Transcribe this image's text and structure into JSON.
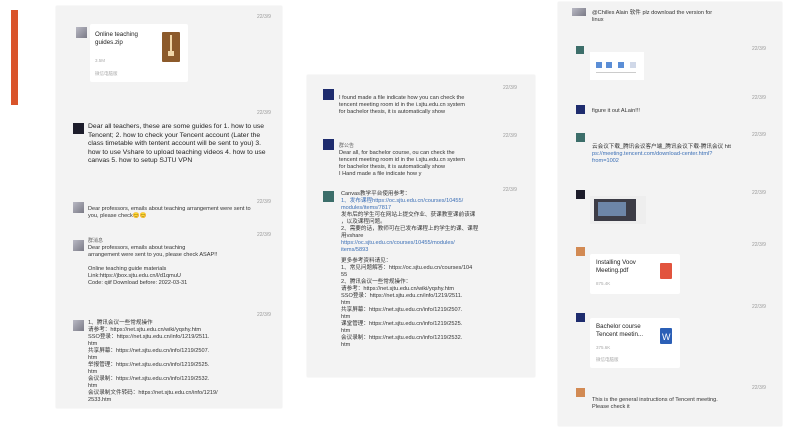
{
  "panel1": {
    "msg1": {
      "time": "22/3/9",
      "file_name": "Online teaching guides.zip",
      "file_size": "3.5M",
      "file_source": "微信电脑版"
    },
    "msg2": {
      "time": "22/3/9",
      "text": "Dear all teachers, these are some guides for 1. how to use Tencent; 2. how to check your Tencent account (Later the class timetable with tentent account will be sent to you) 3. how to use Vshare to upload teaching videos 4. how to use canvas 5. how to setup SJTU VPN"
    },
    "msg3": {
      "time": "22/3/9",
      "text": "Dear professors,  emails about teaching arrangement were sent to you, please check😊😊"
    },
    "msg4": {
      "time": "22/3/9",
      "sender": "群消息",
      "lines": [
        "Dear professors,  emails about teaching",
        "arrangement were sent to you, please check ASAP!!",
        "",
        "Online teaching guide materials",
        "Link:https://jbox.sjtu.edu.cn/l/d1qmuU",
        "Code: qiif  Download before: 2022-03-31"
      ]
    },
    "msg5": {
      "time": "22/3/9",
      "lines": [
        "1、腾讯会议一些常规操作",
        "   请参考：https://net.sjtu.edu.cn/wiki/yqshy.htm",
        "   SSO登录：https://net.sjtu.edu.cn/info/1219/2511.",
        "   htm",
        "   共享屏幕：https://net.sjtu.edu.cn/info/1219/2507.",
        "   htm",
        "   举报管理：https://net.sjtu.edu.cn/info/1219/2525.",
        "   htm",
        "   会议录制：https://net.sjtu.edu.cn/info/1219/2532.",
        "   htm",
        "   会议录制文件转码：https://net.sjtu.edu.cn/info/1219/",
        "   2533.htm"
      ]
    }
  },
  "panel2": {
    "msg1": {
      "time": "22/3/9",
      "lines": [
        "I found made a file indicate how you can check the",
        "tencent meeting room id in the i.sjtu.edu.cn system",
        "for bachelor thesis, it is automatically show"
      ]
    },
    "msg2": {
      "time": "22/3/9",
      "sender": "群公告",
      "lines": [
        "Dear all, for bachelor course, ou can check the",
        "tencent meeting room id in the i.sjtu.edu.cn system",
        "for bachelor thesis, it is automatically show",
        "I Hand made a file indicate how y"
      ]
    },
    "msg3": {
      "time": "22/3/9",
      "lines": [
        "Canvas教学平台使用参考：",
        "1、发布课程https://oc.sjtu.edu.cn/courses/10455/",
        "modules/items/7817",
        "发布后的学生可在网站上提交作业、获课教室课前该课",
        "，以及课程问题。",
        "2、需要的话，教师可在已发布课程上的学生的课、课程",
        "用vshare",
        "https://oc.sjtu.edu.cn/courses/10455/modules/",
        "items/5893",
        "",
        "更多参考资料请见：",
        "1、常见问题解答：https://oc.sjtu.edu.cn/courses/104",
        "55",
        "2、腾讯会议一些常规操作：",
        "请参考：https://net.sjtu.edu.cn/wiki/yqshy.htm",
        "SSO登录：https://net.sjtu.edu.cn/info/1219/2511.",
        "htm",
        "共享屏幕：https://net.sjtu.edu.cn/info/1219/2507.",
        "htm",
        "课堂管理：https://net.sjtu.edu.cn/info/1219/2525.",
        "htm",
        "会议录制：https://net.sjtu.edu.cn/info/1219/2532.",
        "htm"
      ]
    }
  },
  "panel3": {
    "msg0": {
      "lines": [
        "@Chilles Alain 软件 plz download the version for",
        "linux"
      ]
    },
    "msg1": {
      "time": "22/3/9"
    },
    "msg2": {
      "time": "22/3/9",
      "text": "figure it out ALain!!!"
    },
    "msg3": {
      "time": "22/3/9",
      "lines": [
        "云会议下载_腾讯会议客户端_腾讯会议下载-腾讯会议  htt",
        "ps://meeting.tencent.com/download-center.html?",
        "from=1002"
      ]
    },
    "msg4": {
      "time": "22/3/9"
    },
    "msg5": {
      "time": "22/3/9",
      "file_name": "Installing Voov Meeting.pdf",
      "file_size": "875.4K"
    },
    "msg6": {
      "time": "22/3/9",
      "file_name": "Bachelor course Tencent meetin...",
      "file_size": "375.6K",
      "file_source": "微信电脑版"
    },
    "msg7": {
      "time": "22/3/9",
      "lines": [
        "This is the general instructions of Tencent meeting.",
        "Please check it"
      ]
    }
  },
  "colors": {
    "accent": "#d9542b",
    "link": "#3b6fb6",
    "pdf": "#e2543e",
    "word": "#2b5fb6"
  },
  "icons": {
    "zip": "zip-file-icon",
    "pdf": "pdf-file-icon",
    "word": "word-file-icon"
  }
}
